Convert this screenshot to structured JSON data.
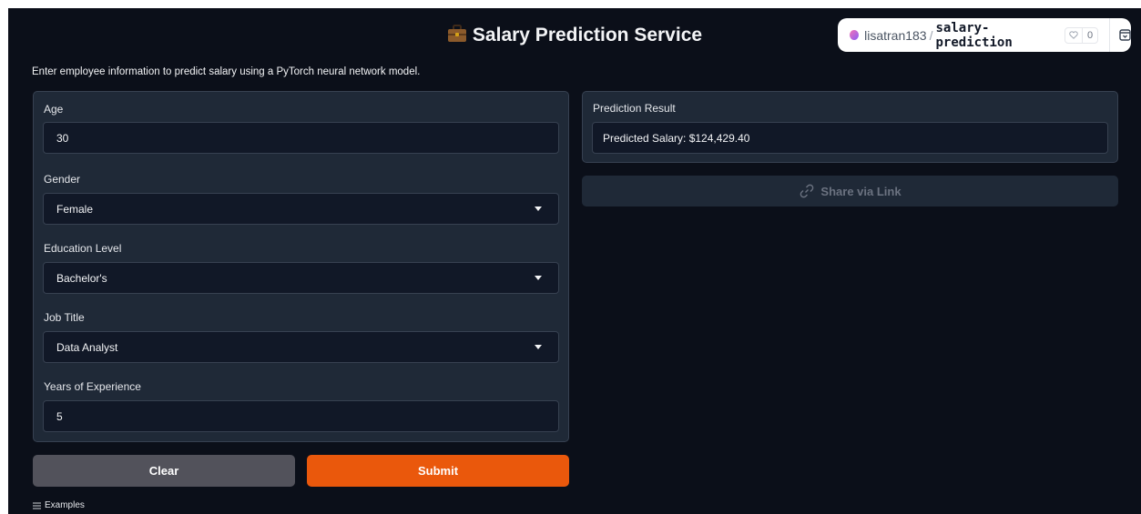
{
  "header": {
    "title": "Salary Prediction Service",
    "title_icon": "briefcase-icon"
  },
  "hf_badge": {
    "user": "lisatran183",
    "separator": "/",
    "repo": "salary-prediction",
    "likes": "0"
  },
  "description": "Enter employee information to predict salary using a PyTorch neural network model.",
  "form": {
    "age": {
      "label": "Age",
      "value": "30"
    },
    "gender": {
      "label": "Gender",
      "value": "Female"
    },
    "education": {
      "label": "Education Level",
      "value": "Bachelor's"
    },
    "job_title": {
      "label": "Job Title",
      "value": "Data Analyst"
    },
    "experience": {
      "label": "Years of Experience",
      "value": "5"
    }
  },
  "result": {
    "label": "Prediction Result",
    "value": "Predicted Salary: $124,429.40"
  },
  "share": {
    "label": "Share via Link",
    "icon": "link-icon"
  },
  "buttons": {
    "clear": "Clear",
    "submit": "Submit"
  },
  "examples": {
    "label": "Examples"
  },
  "colors": {
    "background": "#0b0f19",
    "panel": "#1f2937",
    "accent": "#ea580c",
    "clear_button": "#52525b"
  }
}
